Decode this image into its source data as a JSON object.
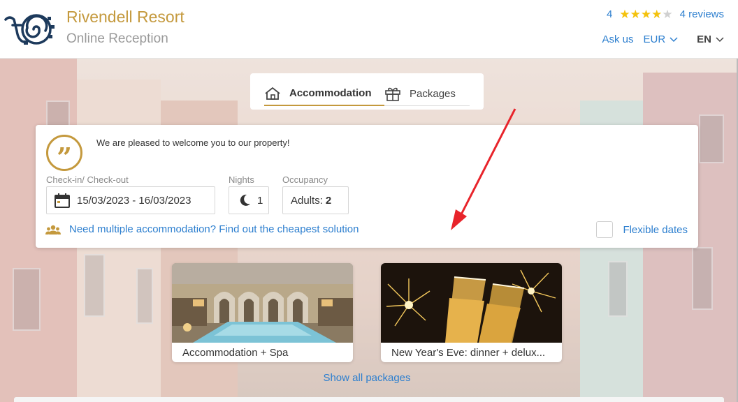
{
  "header": {
    "brand_name": "Rivendell Resort",
    "brand_sub": "Online Reception",
    "rating_value": "4",
    "rating_stars": 4,
    "rating_max": 5,
    "reviews_link": "4 reviews",
    "ask_us": "Ask us",
    "currency": "EUR",
    "language": "EN"
  },
  "tabs": {
    "accommodation": "Accommodation",
    "packages": "Packages",
    "active": "accommodation"
  },
  "search": {
    "welcome": "We are pleased to welcome you to our property!",
    "checkin_label": "Check-in/ Check-out",
    "dates": "15/03/2023 - 16/03/2023",
    "nights_label": "Nights",
    "nights": "1",
    "occupancy_label": "Occupancy",
    "adults_label": "Adults:",
    "adults_count": "2",
    "multi_link": "Need multiple accommodation? Find out the cheapest solution",
    "flexible_dates": "Flexible dates",
    "flexible_checked": false
  },
  "packages": {
    "items": [
      {
        "title": "Accommodation + Spa"
      },
      {
        "title": "New Year's Eve: dinner + delux..."
      }
    ],
    "show_all": "Show all packages"
  },
  "colors": {
    "accent_gold": "#c4993d",
    "link_blue": "#2d7fcf",
    "star_yellow": "#f4c20d",
    "annotation_red": "#e8242b"
  }
}
